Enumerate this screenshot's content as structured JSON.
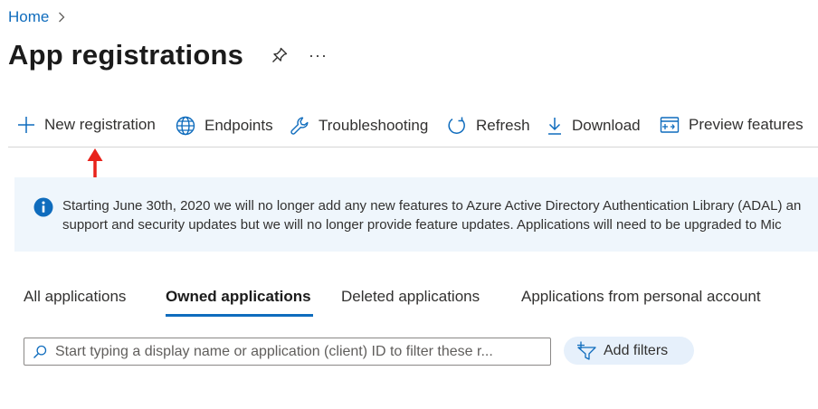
{
  "breadcrumb": {
    "home": "Home"
  },
  "page": {
    "title": "App registrations",
    "more": "···"
  },
  "toolbar": {
    "new_registration": "New registration",
    "endpoints": "Endpoints",
    "troubleshooting": "Troubleshooting",
    "refresh": "Refresh",
    "download": "Download",
    "preview_features": "Preview features"
  },
  "info_banner": {
    "line1": "Starting June 30th, 2020 we will no longer add any new features to Azure Active Directory Authentication Library (ADAL) an",
    "line2": "support and security updates but we will no longer provide feature updates. Applications will need to be upgraded to Mic"
  },
  "tabs": {
    "all": "All applications",
    "owned": "Owned applications",
    "deleted": "Deleted applications",
    "personal": "Applications from personal account",
    "active": "owned"
  },
  "search": {
    "placeholder": "Start typing a display name or application (client) ID to filter these r..."
  },
  "filters": {
    "add_label": "Add filters"
  },
  "colors": {
    "accent": "#0f6cbd",
    "banner_bg": "#eff6fc",
    "annotation_arrow": "#e8221b"
  },
  "icons": [
    "chevron-right-icon",
    "pin-icon",
    "plus-icon",
    "globe-icon",
    "wrench-icon",
    "refresh-icon",
    "download-icon",
    "preview-features-icon",
    "info-icon",
    "search-icon",
    "add-filter-icon"
  ]
}
